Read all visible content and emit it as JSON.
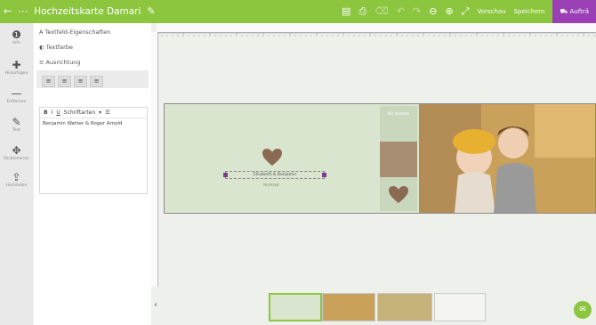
{
  "header": {
    "title": "Hochzeitskarte Damari",
    "preview_label": "Vorschau",
    "save_label": "Speichern",
    "order_label": "Aufträ",
    "colors": {
      "bar": "#8cc63f",
      "accent": "#9b3fb5"
    }
  },
  "iconbar": {
    "items": [
      {
        "icon": "info-icon",
        "label": "Info"
      },
      {
        "icon": "plus-icon",
        "label": "Hinzufügen"
      },
      {
        "icon": "minus-icon",
        "label": "Entfernen"
      },
      {
        "icon": "pencil-icon",
        "label": "Text"
      },
      {
        "icon": "move-icon",
        "label": "Positionieren"
      },
      {
        "icon": "upload-icon",
        "label": "Hochladen"
      }
    ]
  },
  "panel": {
    "text_properties": "Textfeld-Eigenschaften",
    "text_color": "Textfarbe",
    "alignment": "Ausrichtung",
    "font_select": "Schriftarten",
    "text_content": "Benjamin Wetter & Roger Arnold"
  },
  "card": {
    "names": "Elisabeth & Benjamin",
    "subtitle": "Hochzeit",
    "side_text": "Wir heiraten"
  },
  "footer": {
    "collapse_symbol": "‹"
  }
}
